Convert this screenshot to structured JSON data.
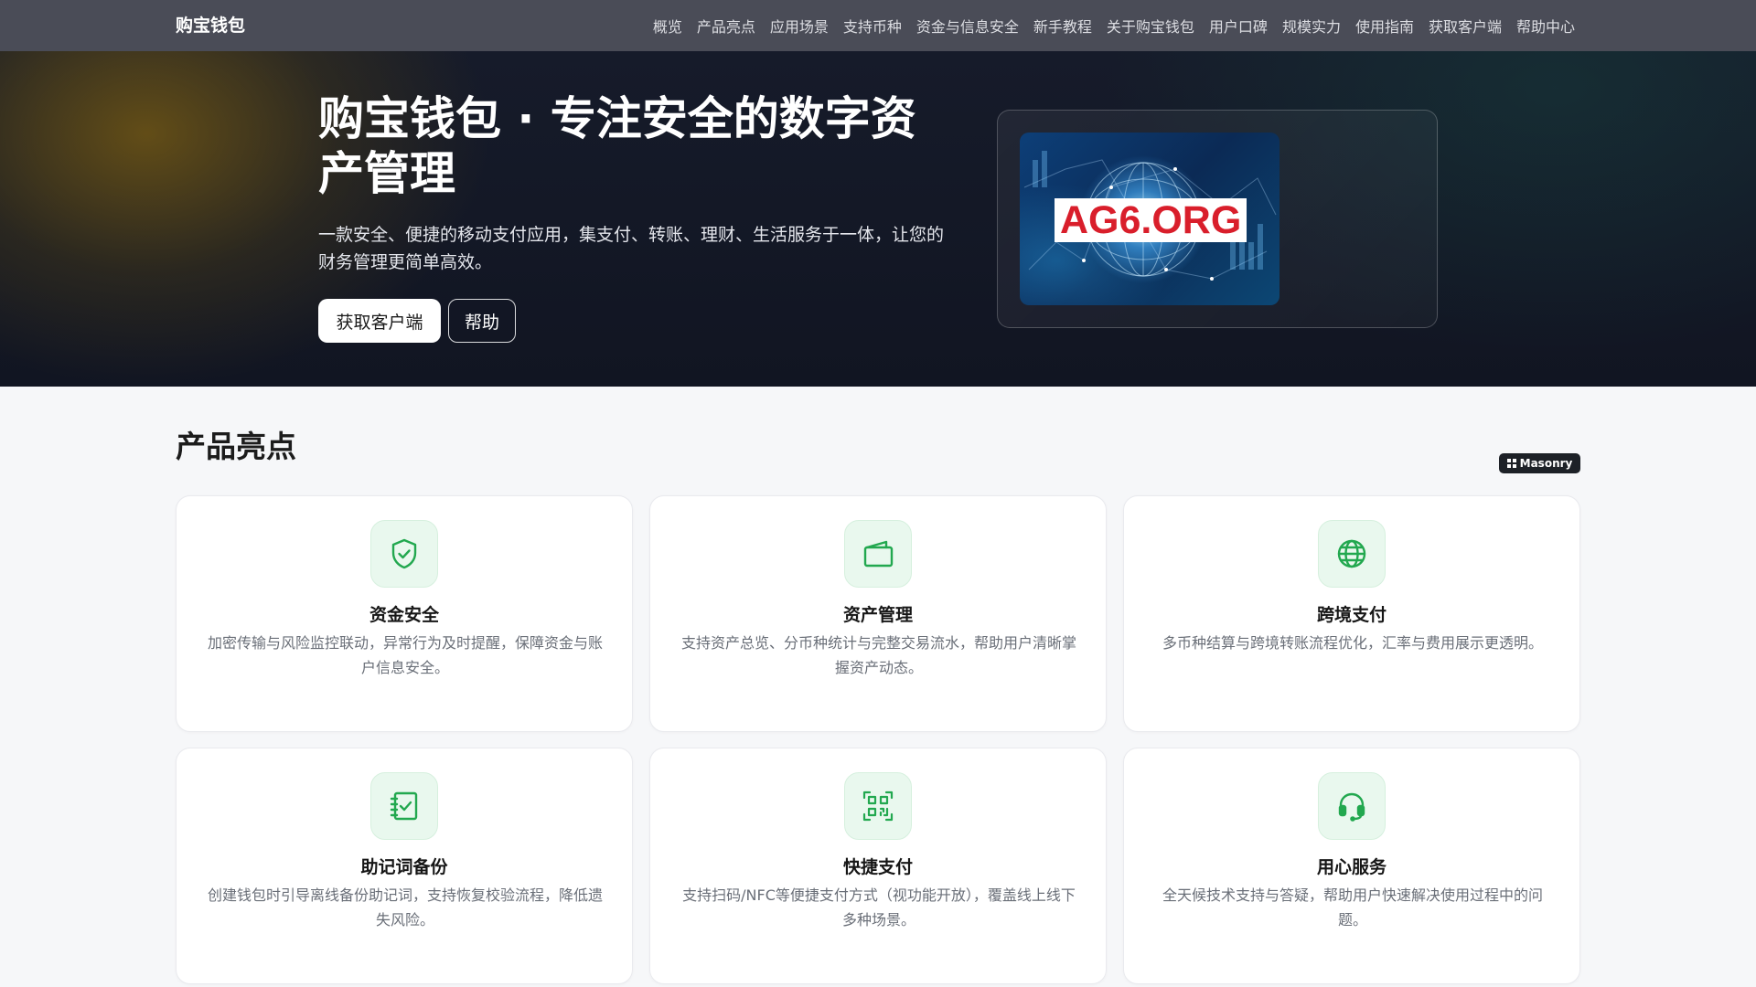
{
  "navbar": {
    "brand": "购宝钱包",
    "links": [
      "概览",
      "产品亮点",
      "应用场景",
      "支持币种",
      "资金与信息安全",
      "新手教程",
      "关于购宝钱包",
      "用户口碑",
      "规模实力",
      "使用指南",
      "获取客户端",
      "帮助中心"
    ]
  },
  "hero": {
    "title": "购宝钱包 · 专注安全的数字资产管理",
    "subtitle": "一款安全、便捷的移动支付应用，集支付、转账、理财、生活服务于一体，让您的财务管理更简单高效。",
    "primary_button": "获取客户端",
    "secondary_button": "帮助",
    "image_label": "AG6.ORG"
  },
  "highlights": {
    "title": "产品亮点",
    "badge": "Masonry",
    "cards": [
      {
        "icon": "shield-check-icon",
        "title": "资金安全",
        "desc": "加密传输与风险监控联动，异常行为及时提醒，保障资金与账户信息安全。"
      },
      {
        "icon": "wallet-icon",
        "title": "资产管理",
        "desc": "支持资产总览、分币种统计与完整交易流水，帮助用户清晰掌握资产动态。"
      },
      {
        "icon": "globe-icon",
        "title": "跨境支付",
        "desc": "多币种结算与跨境转账流程优化，汇率与费用展示更透明。"
      },
      {
        "icon": "notebook-check-icon",
        "title": "助记词备份",
        "desc": "创建钱包时引导离线备份助记词，支持恢复校验流程，降低遗失风险。"
      },
      {
        "icon": "qr-code-icon",
        "title": "快捷支付",
        "desc": "支持扫码/NFC等便捷支付方式（视功能开放），覆盖线上线下多种场景。"
      },
      {
        "icon": "headset-icon",
        "title": "用心服务",
        "desc": "全天候技术支持与答疑，帮助用户快速解决使用过程中的问题。"
      }
    ]
  },
  "colors": {
    "accent_green": "#22a84f",
    "navbar_bg": "#4a4c57",
    "image_label_red": "#d91e2b"
  }
}
